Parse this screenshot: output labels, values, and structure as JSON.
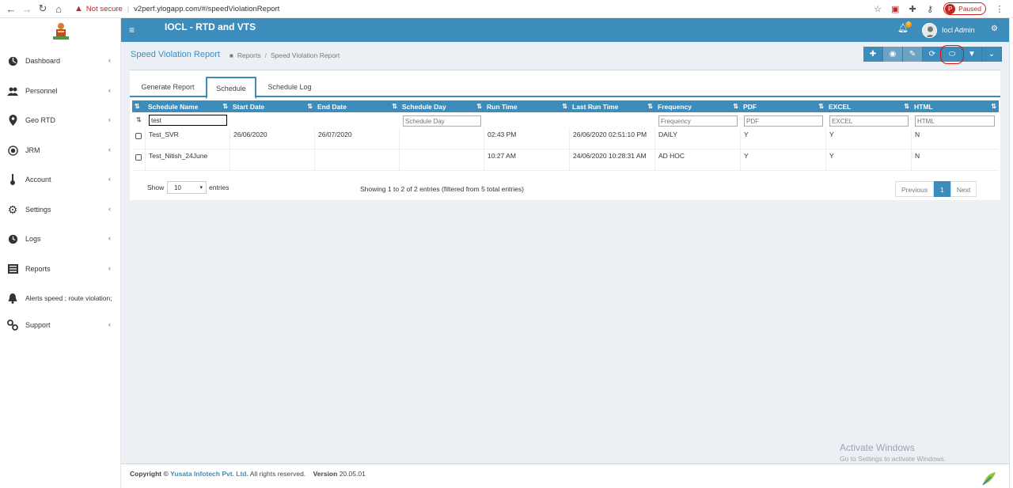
{
  "browser": {
    "not_secure": "Not secure",
    "url": "v2perf.ylogapp.com/#/speedViolationReport",
    "profile_initial": "P",
    "profile_status": "Paused",
    "icons": [
      "back-icon",
      "forward-icon",
      "reload-icon",
      "home-icon",
      "star-icon",
      "extension-icon",
      "puzzle-icon",
      "key-icon",
      "menu-icon"
    ]
  },
  "app": {
    "title": "IOCL - RTD and VTS",
    "user_name": "Iocl Admin",
    "notification_count": "0",
    "accent": "#3c8dbc"
  },
  "sidebar": {
    "items": [
      {
        "label": "Dashboard",
        "icon": "dashboard-icon",
        "has_chevron": true
      },
      {
        "label": "Personnel",
        "icon": "users-icon",
        "has_chevron": true
      },
      {
        "label": "Geo RTD",
        "icon": "map-marker-icon",
        "has_chevron": true
      },
      {
        "label": "JRM",
        "icon": "globe-icon",
        "has_chevron": true
      },
      {
        "label": "Account",
        "icon": "thermometer-icon",
        "has_chevron": true
      },
      {
        "label": "Settings",
        "icon": "gear-icon",
        "has_chevron": true
      },
      {
        "label": "Logs",
        "icon": "clock-icon",
        "has_chevron": true
      },
      {
        "label": "Reports",
        "icon": "list-icon",
        "has_chevron": true
      },
      {
        "label": "Alerts speed ; route violation;",
        "icon": "bell-icon",
        "has_chevron": false
      },
      {
        "label": "Support",
        "icon": "link-icon",
        "has_chevron": true
      }
    ],
    "chevron": "‹"
  },
  "page": {
    "title": "Speed Violation Report",
    "breadcrumb": [
      "Reports",
      "Speed Violation Report"
    ],
    "toolbar_icons": [
      "plus-icon",
      "eye-icon",
      "pencil-icon",
      "refresh-icon",
      "toggle-icon",
      "filter-icon",
      "chevron-down-icon"
    ]
  },
  "tabs": [
    {
      "label": "Generate Report",
      "active": false
    },
    {
      "label": "Schedule",
      "active": true
    },
    {
      "label": "Schedule Log",
      "active": false
    }
  ],
  "table": {
    "columns": [
      "Schedule Name",
      "Start Date",
      "End Date",
      "Schedule Day",
      "Run Time",
      "Last Run Time",
      "Frequency",
      "PDF",
      "EXCEL",
      "HTML"
    ],
    "filters": {
      "schedule_name_value": "test",
      "schedule_day_placeholder": "Schedule Day",
      "frequency_placeholder": "Frequency",
      "pdf_placeholder": "PDF",
      "excel_placeholder": "EXCEL",
      "html_placeholder": "HTML"
    },
    "rows": [
      {
        "name": "Test_SVR",
        "start": "26/06/2020",
        "end": "26/07/2020",
        "day": "",
        "run": "02:43 PM",
        "last_run": "26/06/2020 02:51:10 PM",
        "frequency": "DAILY",
        "pdf": "Y",
        "excel": "Y",
        "html": "N"
      },
      {
        "name": "Test_Nitish_24June",
        "start": "",
        "end": "",
        "day": "",
        "run": "10:27 AM",
        "last_run": "24/06/2020 10:28:31 AM",
        "frequency": "AD HOC",
        "pdf": "Y",
        "excel": "Y",
        "html": "N"
      }
    ],
    "show_label": "Show",
    "page_size": "10",
    "entries_label": "entries",
    "info": "Showing 1 to 2 of 2 entries (filtered from 5 total entries)",
    "pagination": {
      "previous": "Previous",
      "current": "1",
      "next": "Next"
    }
  },
  "footer": {
    "copyright": "Copyright ©",
    "company": "Yusata Infotech Pvt. Ltd.",
    "rights": "All rights reserved.",
    "version_label": "Version",
    "version": "20.05.01"
  },
  "watermark": {
    "line1": "Activate Windows",
    "line2": "Go to Settings to activate Windows."
  }
}
